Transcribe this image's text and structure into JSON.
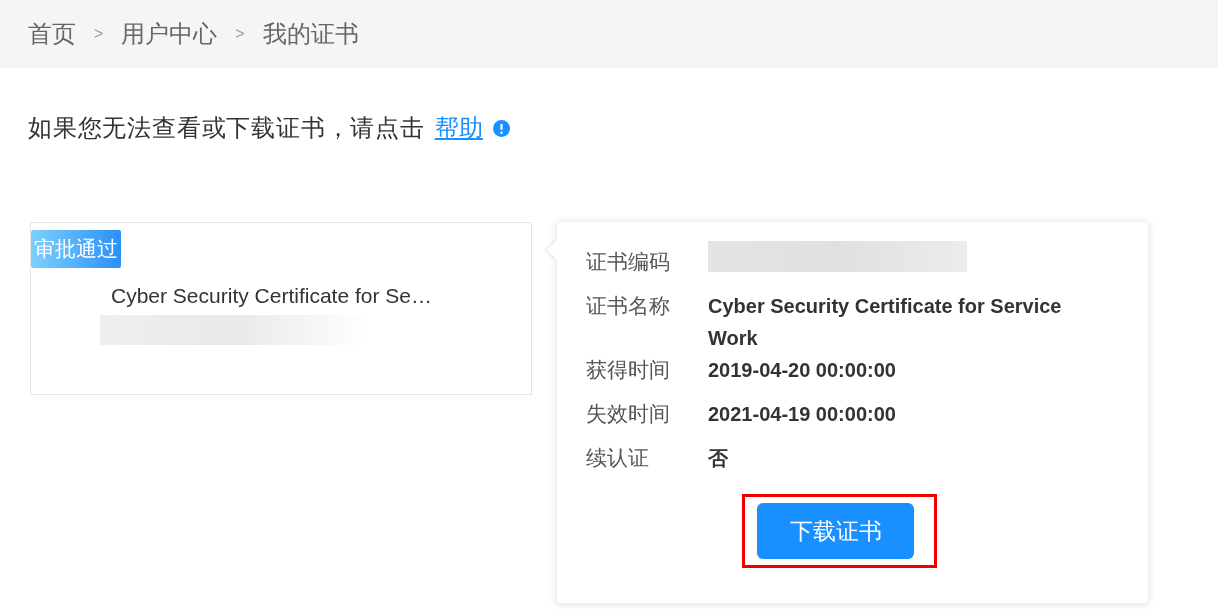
{
  "breadcrumb": [
    {
      "kind": "link",
      "text": "首页"
    },
    {
      "kind": "separator",
      "text": ">"
    },
    {
      "kind": "link",
      "text": "用户中心"
    },
    {
      "kind": "separator",
      "text": ">"
    },
    {
      "kind": "current",
      "text": "我的证书"
    }
  ],
  "help_notice": {
    "text": "如果您无法查看或下载证书，请点击",
    "link": "帮助"
  },
  "certificate_card": {
    "status_badge": "审批通过",
    "title": "Cyber Security Certificate for Se…"
  },
  "details_popover": {
    "fields": [
      {
        "kind": "redacted",
        "label": "证书编码"
      },
      {
        "kind": "text",
        "label": "证书名称",
        "value": "Cyber Security Certificate for Service Work"
      },
      {
        "kind": "text",
        "label": "获得时间",
        "value": "2019-04-20 00:00:00"
      },
      {
        "kind": "text",
        "label": "失效时间",
        "value": "2021-04-19 00:00:00"
      },
      {
        "kind": "text",
        "label": "续认证",
        "value": "否"
      }
    ],
    "download_button": {
      "label": "下载证书",
      "highlighted": true
    }
  }
}
